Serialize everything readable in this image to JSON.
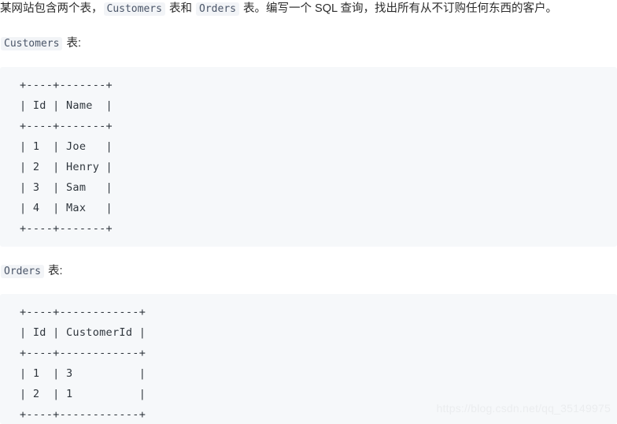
{
  "problem": {
    "statement_parts": [
      {
        "type": "text",
        "value": "某网站包含两个表，"
      },
      {
        "type": "code",
        "value": "Customers"
      },
      {
        "type": "text",
        "value": " 表和 "
      },
      {
        "type": "code",
        "value": "Orders"
      },
      {
        "type": "text",
        "value": " 表。编写一个 SQL 查询，找出所有从不订购任何东西的客户。"
      }
    ],
    "statement_full": "某网站包含两个表，Customers 表和 Orders 表。编写一个 SQL 查询，找出所有从不订购任何东西的客户。"
  },
  "sections": [
    {
      "id": "customers",
      "heading_code": "Customers",
      "heading_suffix": " 表:",
      "table": {
        "columns": [
          "Id",
          "Name"
        ],
        "rows": [
          [
            "1",
            "Joe"
          ],
          [
            "2",
            "Henry"
          ],
          [
            "3",
            "Sam"
          ],
          [
            "4",
            "Max"
          ]
        ],
        "ascii": "+----+-------+\n| Id | Name  |\n+----+-------+\n| 1  | Joe   |\n| 2  | Henry |\n| 3  | Sam   |\n| 4  | Max   |\n+----+-------+"
      }
    },
    {
      "id": "orders",
      "heading_code": "Orders",
      "heading_suffix": " 表:",
      "table": {
        "columns": [
          "Id",
          "CustomerId"
        ],
        "rows": [
          [
            "1",
            "3"
          ],
          [
            "2",
            "1"
          ]
        ],
        "ascii": "+----+------------+\n| Id | CustomerId |\n+----+------------+\n| 1  | 3          |\n| 2  | 1          |\n+----+------------+"
      }
    }
  ],
  "watermark": {
    "text": "https://blog.csdn.net/qq_35149975"
  },
  "colors": {
    "page_background": "#ffffff",
    "code_block_background": "#f6f8fa",
    "code_text": "#2f363d",
    "inline_code_text": "#4a5568",
    "inline_code_background": "#f2f4f7",
    "body_text": "#2b2b2b",
    "watermark_text": "#ebedef"
  }
}
